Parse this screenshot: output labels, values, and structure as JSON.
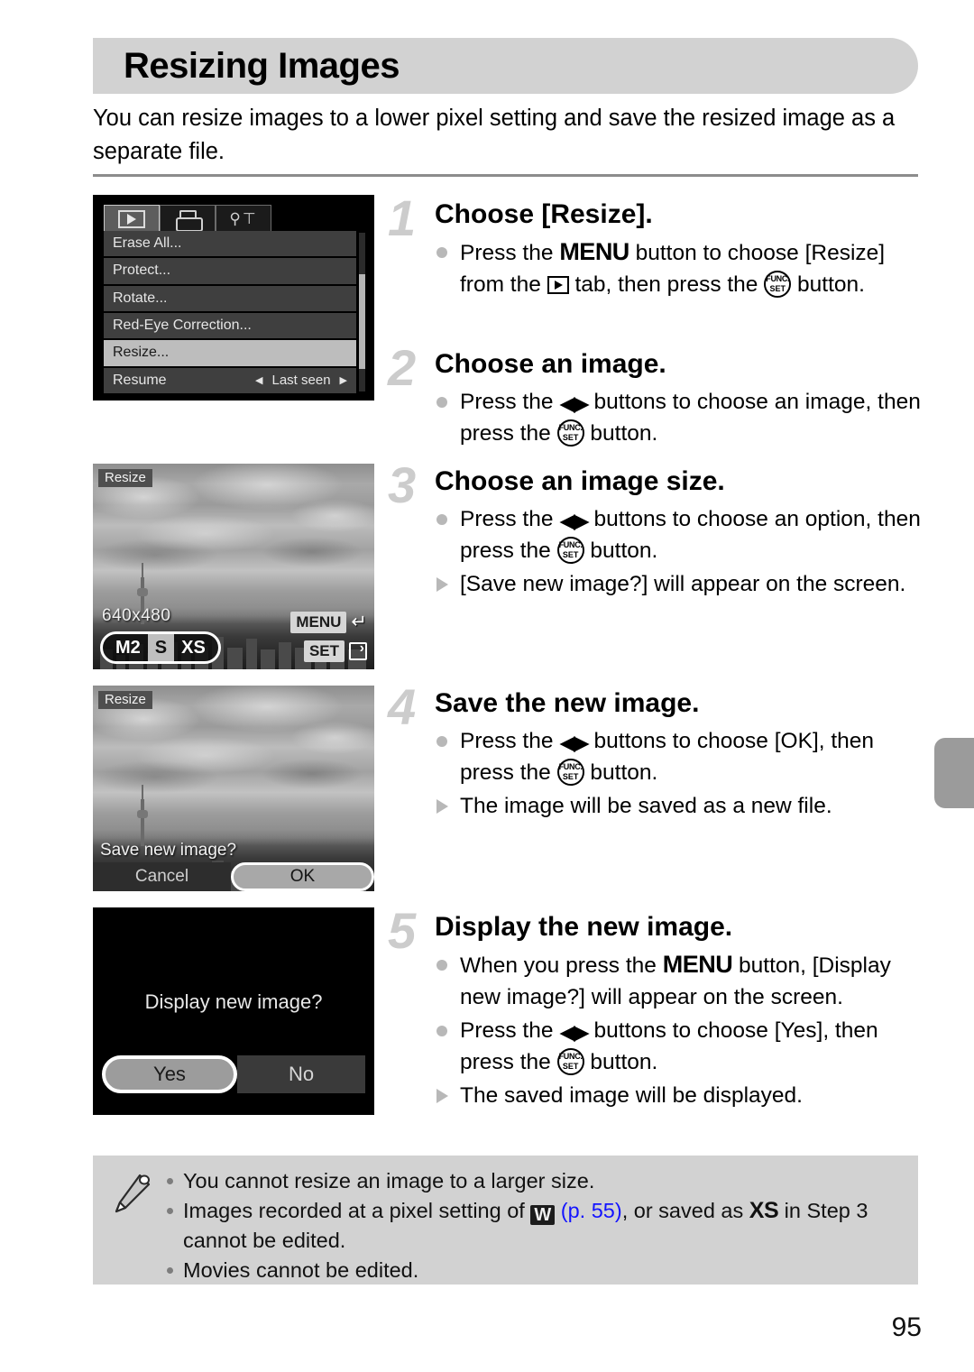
{
  "header": {
    "title": "Resizing Images",
    "intro": "You can resize images to a lower pixel setting and save the resized image as a separate file."
  },
  "colors": {
    "header_bg": "#d2d2d2",
    "note_bg": "#d2d2d2",
    "step_number": "#cccccc",
    "link": "#1414ff",
    "page_tab": "#9b9b9b"
  },
  "menu_screen": {
    "tabs": [
      {
        "icon": "playback-icon",
        "active": true
      },
      {
        "icon": "print-icon",
        "active": false
      },
      {
        "icon": "settings-tools-icon",
        "active": false
      }
    ],
    "items": [
      {
        "label": "Erase All...",
        "value": "",
        "selected": false
      },
      {
        "label": "Protect...",
        "value": "",
        "selected": false
      },
      {
        "label": "Rotate...",
        "value": "",
        "selected": false
      },
      {
        "label": "Red-Eye Correction...",
        "value": "",
        "selected": false
      },
      {
        "label": "Resize...",
        "value": "",
        "selected": true
      },
      {
        "label": "Resume",
        "value": "Last seen",
        "selected": false
      }
    ]
  },
  "resize_screen": {
    "label": "Resize",
    "resolution": "640x480",
    "size_options": [
      {
        "label": "M2",
        "selected": false
      },
      {
        "label": "S",
        "selected": true
      },
      {
        "label": "XS",
        "selected": false
      }
    ],
    "menu_key": "MENU",
    "set_key": "SET"
  },
  "save_screen": {
    "label": "Resize",
    "question": "Save new image?",
    "buttons": [
      {
        "label": "Cancel",
        "selected": false
      },
      {
        "label": "OK",
        "selected": true
      }
    ]
  },
  "display_screen": {
    "question": "Display new image?",
    "buttons": [
      {
        "label": "Yes",
        "selected": true
      },
      {
        "label": "No",
        "selected": false
      }
    ]
  },
  "steps": [
    {
      "number": "1",
      "heading": "Choose [Resize].",
      "lines": [
        {
          "type": "dot",
          "a": "Press the ",
          "kw": "MENU",
          "b": " button to choose [Resize] from the ",
          "icon": "playback",
          "c": " tab, then press the ",
          "icon2": "func-set",
          "d": " button."
        }
      ]
    },
    {
      "number": "2",
      "heading": "Choose an image.",
      "lines": [
        {
          "type": "dot",
          "a": "Press the ",
          "icon": "left-right-arrows",
          "b": " buttons to choose an image, then press the ",
          "icon2": "func-set",
          "c": " button."
        }
      ]
    },
    {
      "number": "3",
      "heading": "Choose an image size.",
      "lines": [
        {
          "type": "dot",
          "a": "Press the ",
          "icon": "left-right-arrows",
          "b": " buttons to choose an option, then press the ",
          "icon2": "func-set",
          "c": " button."
        },
        {
          "type": "tri",
          "a": "[Save new image?] will appear on the screen."
        }
      ]
    },
    {
      "number": "4",
      "heading": "Save the new image.",
      "lines": [
        {
          "type": "dot",
          "a": "Press the ",
          "icon": "left-right-arrows",
          "b": " buttons to choose [OK], then press the ",
          "icon2": "func-set",
          "c": " button."
        },
        {
          "type": "tri",
          "a": "The image will be saved as a new file."
        }
      ]
    },
    {
      "number": "5",
      "heading": "Display the new image.",
      "lines": [
        {
          "type": "dot",
          "a": "When you press the ",
          "kw": "MENU",
          "b": " button, [Display new image?] will appear on the screen."
        },
        {
          "type": "dot",
          "a": "Press the ",
          "icon": "left-right-arrows",
          "b": " buttons to choose [Yes], then press the ",
          "icon2": "func-set",
          "c": " button."
        },
        {
          "type": "tri",
          "a": "The saved image will be displayed."
        }
      ]
    }
  ],
  "notes": {
    "icon": "pencil-icon",
    "items": [
      {
        "text": "You cannot resize an image to a larger size."
      },
      {
        "pre": "Images recorded at a pixel setting of ",
        "icon_w": "W",
        "link": "(p. 55)",
        "mid": ", or saved as ",
        "icon_xs": "XS",
        "post": " in Step 3 cannot be edited."
      },
      {
        "text": "Movies cannot be edited."
      }
    ]
  },
  "page_number": "95",
  "func_set_icon": {
    "line1": "FUNC.",
    "line2": "SET"
  }
}
